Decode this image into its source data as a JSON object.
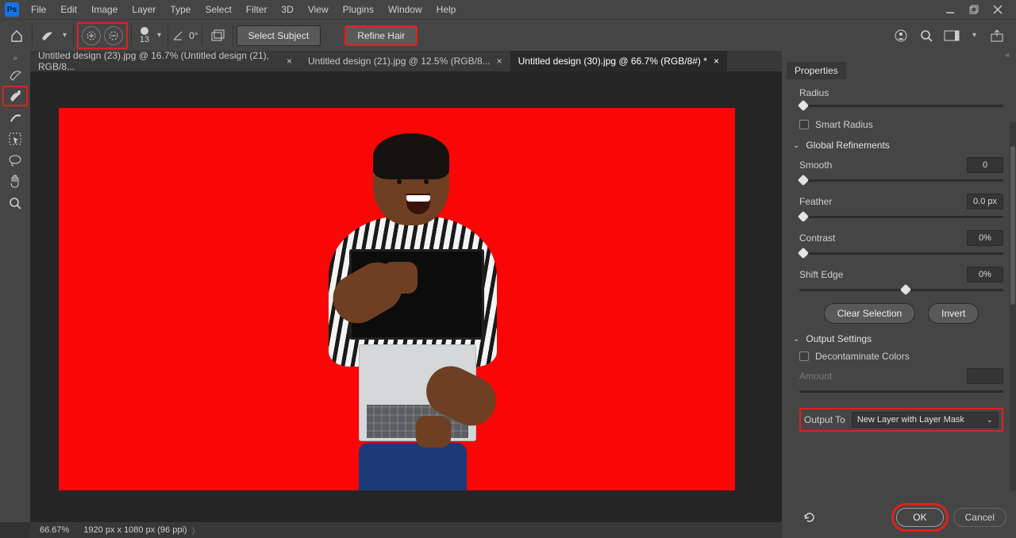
{
  "menubar": {
    "items": [
      "File",
      "Edit",
      "Image",
      "Layer",
      "Type",
      "Select",
      "Filter",
      "3D",
      "View",
      "Plugins",
      "Window",
      "Help"
    ]
  },
  "optionsbar": {
    "brush_size": "13",
    "angle": "0°",
    "select_subject": "Select Subject",
    "refine_hair": "Refine Hair"
  },
  "tabs": [
    {
      "label": "Untitled design (23).jpg @ 16.7% (Untitled design (21), RGB/8...",
      "active": false
    },
    {
      "label": "Untitled design (21).jpg @ 12.5% (RGB/8...",
      "active": false
    },
    {
      "label": "Untitled design (30).jpg @ 66.7% (RGB/8#) *",
      "active": true
    }
  ],
  "properties": {
    "panel_title": "Properties",
    "radius_label": "Radius",
    "smart_radius_label": "Smart Radius",
    "global_section": "Global Refinements",
    "smooth_label": "Smooth",
    "smooth_value": "0",
    "feather_label": "Feather",
    "feather_value": "0.0 px",
    "contrast_label": "Contrast",
    "contrast_value": "0%",
    "shift_label": "Shift Edge",
    "shift_value": "0%",
    "clear_selection": "Clear Selection",
    "invert": "Invert",
    "output_section": "Output Settings",
    "decontaminate_label": "Decontaminate Colors",
    "amount_label": "Amount",
    "output_to_label": "Output To",
    "output_to_value": "New Layer with Layer Mask",
    "ok": "OK",
    "cancel": "Cancel"
  },
  "status": {
    "zoom": "66.67%",
    "doc_info": "1920 px x 1080 px (96 ppi)"
  }
}
